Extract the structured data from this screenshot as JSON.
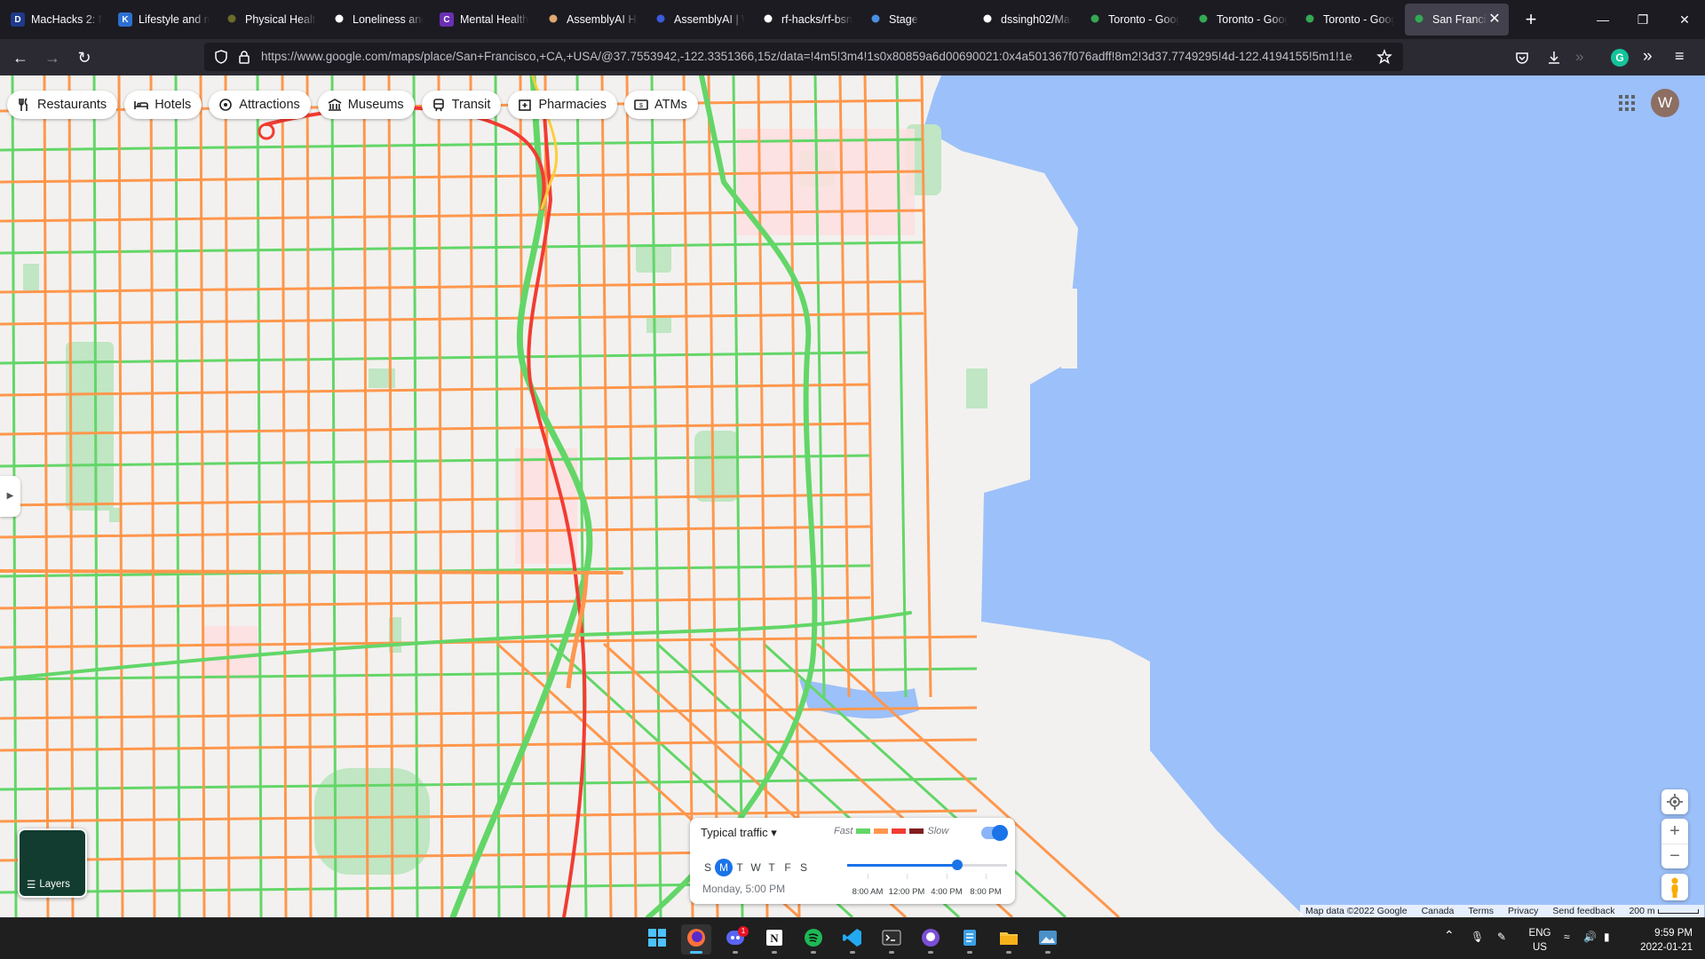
{
  "browser": {
    "tabs": [
      {
        "title": "MacHacks 2: M",
        "icon": "letter-d-icon",
        "icon_text": "D",
        "color": "#1d3b8a"
      },
      {
        "title": "Lifestyle and m",
        "icon": "letter-k-icon",
        "icon_text": "K",
        "color": "#2d6fd1"
      },
      {
        "title": "Physical Health",
        "icon": "shoe-icon",
        "icon_text": "",
        "color": "#6b6b2a"
      },
      {
        "title": "Loneliness and",
        "icon": "page-icon",
        "icon_text": "",
        "color": "#ffffff"
      },
      {
        "title": "Mental Health",
        "icon": "letter-c-icon",
        "icon_text": "C",
        "color": "#6b2fb3"
      },
      {
        "title": "AssemblyAI Ha",
        "icon": "person-icon",
        "icon_text": "",
        "color": "#e0a96d"
      },
      {
        "title": "AssemblyAI | W",
        "icon": "assemblyai-icon",
        "icon_text": "",
        "color": "#3b5bdb"
      },
      {
        "title": "rf-hacks/rf-bsn",
        "icon": "github-icon",
        "icon_text": "",
        "color": "#ffffff"
      },
      {
        "title": "Stage",
        "icon": "gear-icon",
        "icon_text": "",
        "color": "#4a90e2"
      },
      {
        "title": "dssingh02/Mac",
        "icon": "github-icon",
        "icon_text": "",
        "color": "#ffffff"
      },
      {
        "title": "Toronto - Goog",
        "icon": "maps-pin-icon",
        "icon_text": "",
        "color": "#34a853"
      },
      {
        "title": "Toronto - Goog",
        "icon": "maps-pin-icon",
        "icon_text": "",
        "color": "#34a853"
      },
      {
        "title": "Toronto - Goog",
        "icon": "maps-pin-icon",
        "icon_text": "",
        "color": "#34a853"
      },
      {
        "title": "San Francisc",
        "icon": "maps-pin-icon",
        "icon_text": "",
        "color": "#34a853",
        "active": true
      }
    ],
    "url": "https://www.google.com/maps/place/San+Francisco,+CA,+USA/@37.7553942,-122.3351366,15z/data=!4m5!3m4!1s0x80859a6d00690021:0x4a501367f076adff!8m2!3d37.7749295!4d-122.4194155!5m1!1e1"
  },
  "map": {
    "categories": [
      "Restaurants",
      "Hotels",
      "Attractions",
      "Museums",
      "Transit",
      "Pharmacies",
      "ATMs"
    ],
    "avatar_letter": "W",
    "layers_label": "Layers",
    "traffic": {
      "mode": "Typical traffic",
      "fast_label": "Fast",
      "slow_label": "Slow",
      "legend_colors": [
        "#63d668",
        "#ff974d",
        "#f23c32",
        "#811f1f"
      ],
      "days": [
        "S",
        "M",
        "T",
        "W",
        "T",
        "F",
        "S"
      ],
      "selected_day_index": 1,
      "selected_time": "Monday, 5:00 PM",
      "time_labels": [
        "8:00 AM",
        "12:00 PM",
        "4:00 PM",
        "8:00 PM"
      ],
      "slider_fraction": 0.69,
      "toggle_on": true
    },
    "footer": {
      "map_data": "Map data ©2022 Google",
      "region": "Canada",
      "terms": "Terms",
      "privacy": "Privacy",
      "feedback": "Send feedback",
      "scale": "200 m"
    },
    "colors": {
      "water": "#9cc0f9",
      "land": "#f2f1ef",
      "park": "#c0e6c3",
      "fast": "#63d668",
      "medium": "#ff974d",
      "slow": "#f23c32"
    }
  },
  "taskbar": {
    "apps": [
      "windows-start-icon",
      "firefox-icon",
      "discord-icon",
      "notion-icon",
      "spotify-icon",
      "vscode-icon",
      "terminal-icon",
      "github-desktop-icon",
      "notepad-icon",
      "file-explorer-icon",
      "photos-icon"
    ],
    "discord_badge": "1",
    "lang_top": "ENG",
    "lang_bottom": "US",
    "time": "9:59 PM",
    "date": "2022-01-21"
  }
}
